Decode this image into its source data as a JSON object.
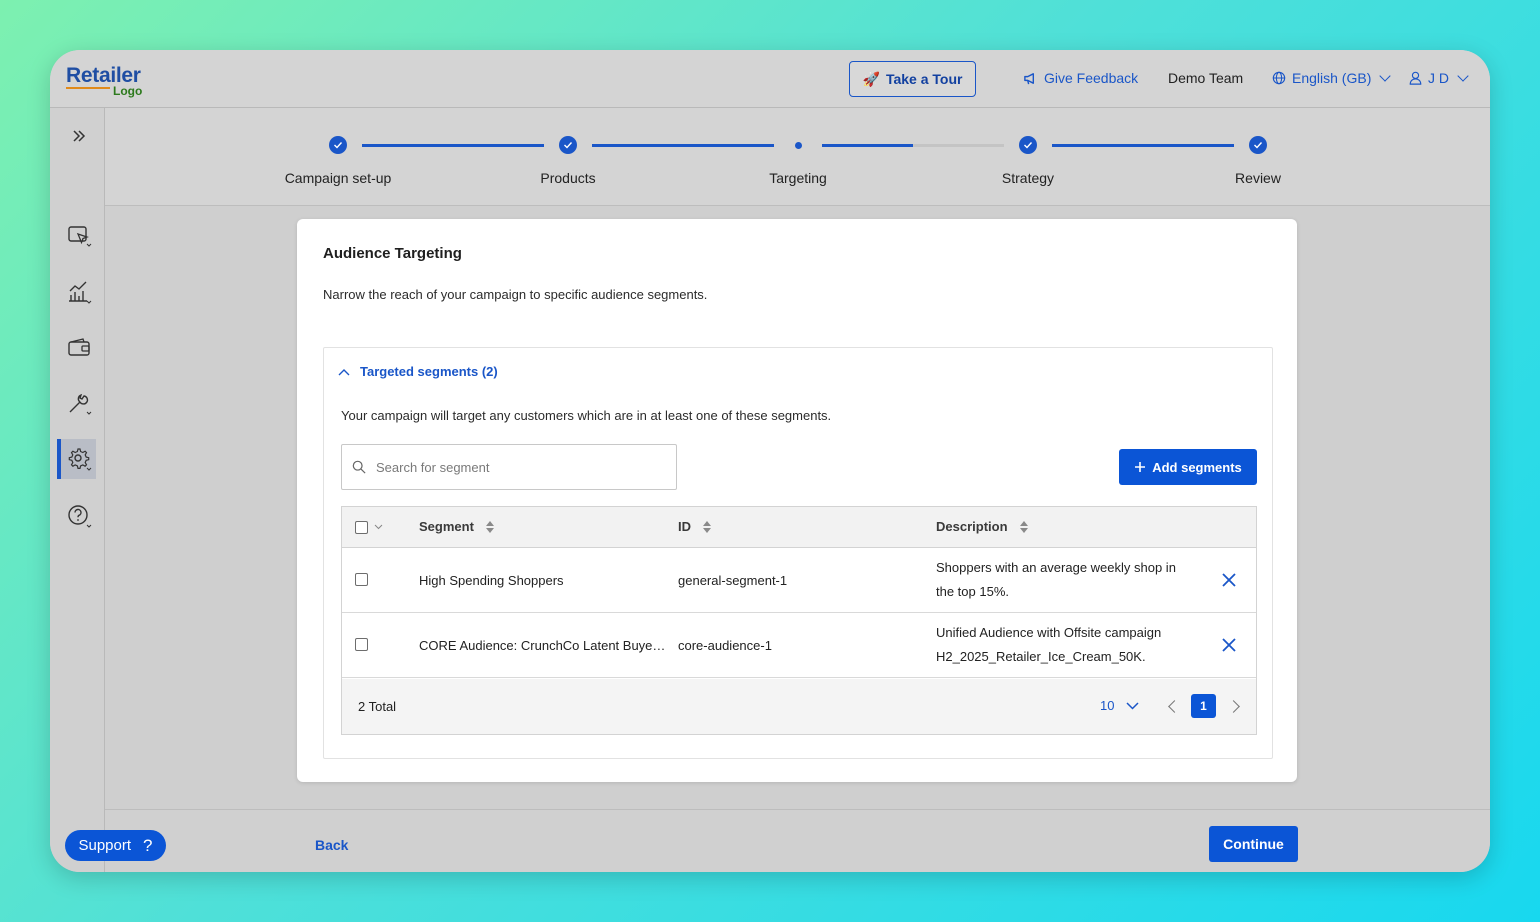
{
  "brand": {
    "line1": "Retailer",
    "line2": "Logo"
  },
  "header": {
    "tour_icon": "🚀",
    "tour_label": "Take a Tour",
    "feedback_label": "Give Feedback",
    "team_label": "Demo Team",
    "language_label": "English (GB)",
    "user_label": "J D"
  },
  "sidebar": {
    "items": [
      {
        "icon": "expand-icon"
      },
      {
        "icon": "campaign-cursor-icon"
      },
      {
        "icon": "analytics-icon"
      },
      {
        "icon": "wallet-icon"
      },
      {
        "icon": "tools-icon"
      },
      {
        "icon": "settings-icon",
        "active": true
      },
      {
        "icon": "help-icon"
      }
    ]
  },
  "stepper": {
    "steps": [
      {
        "label": "Campaign set-up",
        "state": "done"
      },
      {
        "label": "Products",
        "state": "done"
      },
      {
        "label": "Targeting",
        "state": "current"
      },
      {
        "label": "Strategy",
        "state": "done"
      },
      {
        "label": "Review",
        "state": "done"
      }
    ]
  },
  "card": {
    "title": "Audience Targeting",
    "subtitle": "Narrow the reach of your campaign to specific audience segments."
  },
  "segments": {
    "header": "Targeted segments (2)",
    "description": "Your campaign will target any customers which are in at least one of these segments.",
    "search_placeholder": "Search for segment",
    "add_label": "Add segments",
    "columns": [
      "Segment",
      "ID",
      "Description"
    ],
    "rows": [
      {
        "segment": "High Spending Shoppers",
        "id": "general-segment-1",
        "description": "Shoppers with an average weekly shop in the top 15%."
      },
      {
        "segment": "CORE Audience: CrunchCo Latent Buye…",
        "id": "core-audience-1",
        "description": "Unified Audience with Offsite campaign H2_2025_Retailer_Ice_Cream_50K."
      }
    ],
    "total_label": "2 Total",
    "page_size": "10",
    "current_page": "1"
  },
  "footer": {
    "back_label": "Back",
    "continue_label": "Continue",
    "support_label": "Support",
    "support_icon": "?"
  },
  "colors": {
    "accent": "#0b55d6",
    "link": "#1a56c8"
  }
}
